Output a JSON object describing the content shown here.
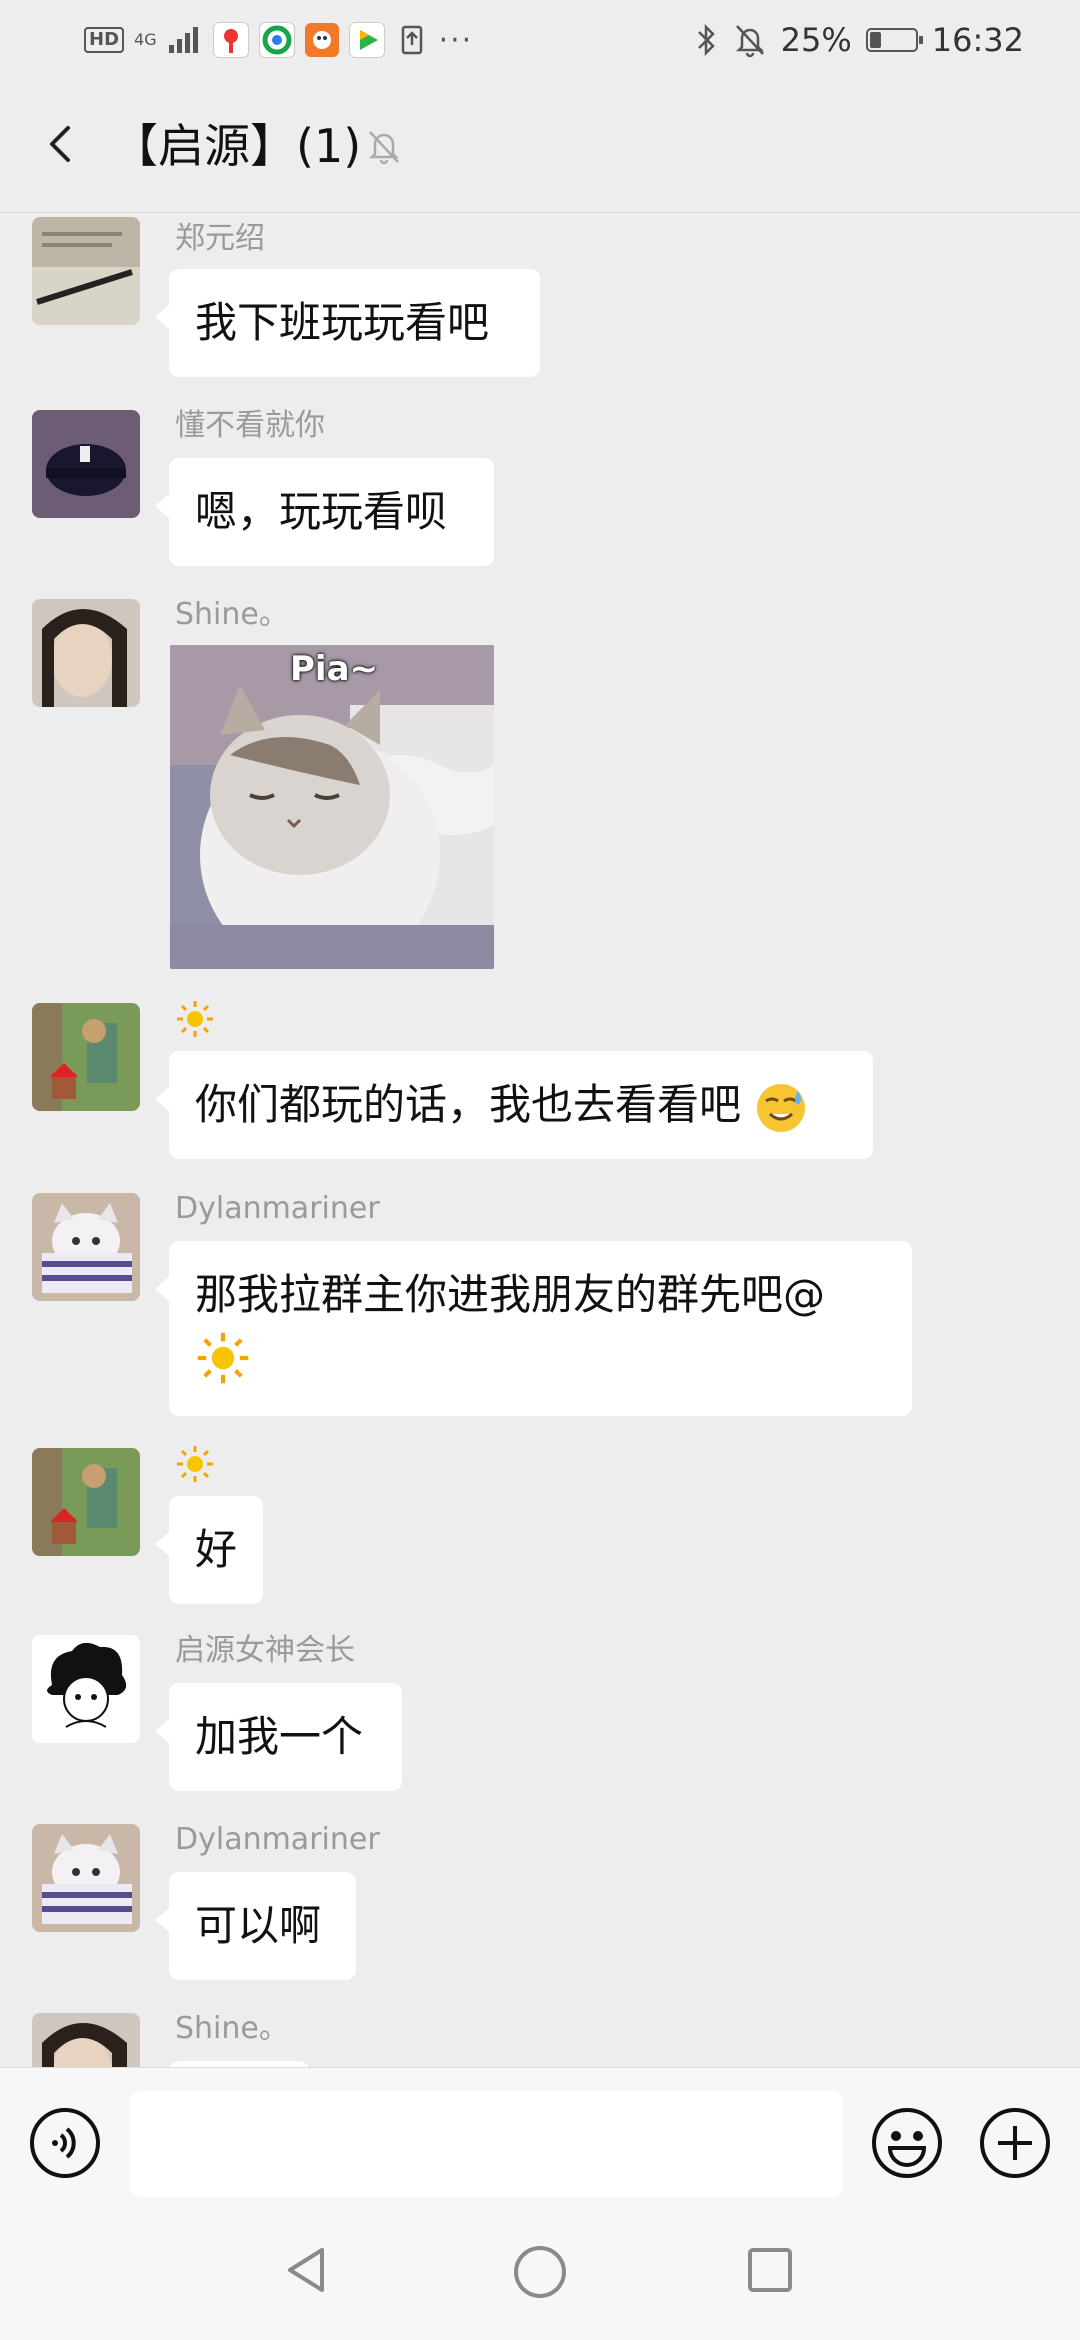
{
  "status_bar": {
    "left_badges": [
      "HD",
      "4G"
    ],
    "battery_percent": "25%",
    "battery_level": 0.25,
    "time": "16:32",
    "overflow": "···"
  },
  "header": {
    "title": "【启源】(1)",
    "back_icon": "chevron-left-icon",
    "mute_icon": "bell-off-icon"
  },
  "messages": [
    {
      "sender": "郑元绍",
      "text": "我下班玩玩看吧"
    },
    {
      "sender": "懂不看就你",
      "text": "嗯，玩玩看呗"
    },
    {
      "sender": "Shine。",
      "sticker_caption": "Pia~"
    },
    {
      "sender_icon": "sun-icon",
      "text": "你们都玩的话，我也去看看吧",
      "trailing_emoji": "sweat-smile-emoji"
    },
    {
      "sender": "Dylanmariner",
      "text": "那我拉群主你进我朋友的群先吧@",
      "mention_icon": "sun-icon"
    },
    {
      "sender_icon": "sun-icon",
      "text": "好"
    },
    {
      "sender": "启源女神会长",
      "text": "加我一个"
    },
    {
      "sender": "Dylanmariner",
      "text": "可以啊"
    },
    {
      "sender": "Shine。",
      "text": ""
    }
  ],
  "input_bar": {
    "voice_icon": "voice-icon",
    "input_value": "",
    "emoji_icon": "smiley-icon",
    "more_icon": "plus-circle-icon"
  },
  "nav_bar": {
    "back_icon": "triangle-back-icon",
    "home_icon": "circle-home-icon",
    "recent_icon": "square-recent-icon"
  },
  "colors": {
    "background": "#ededed",
    "bubble": "#ffffff",
    "name_text": "#9a9a9a"
  }
}
